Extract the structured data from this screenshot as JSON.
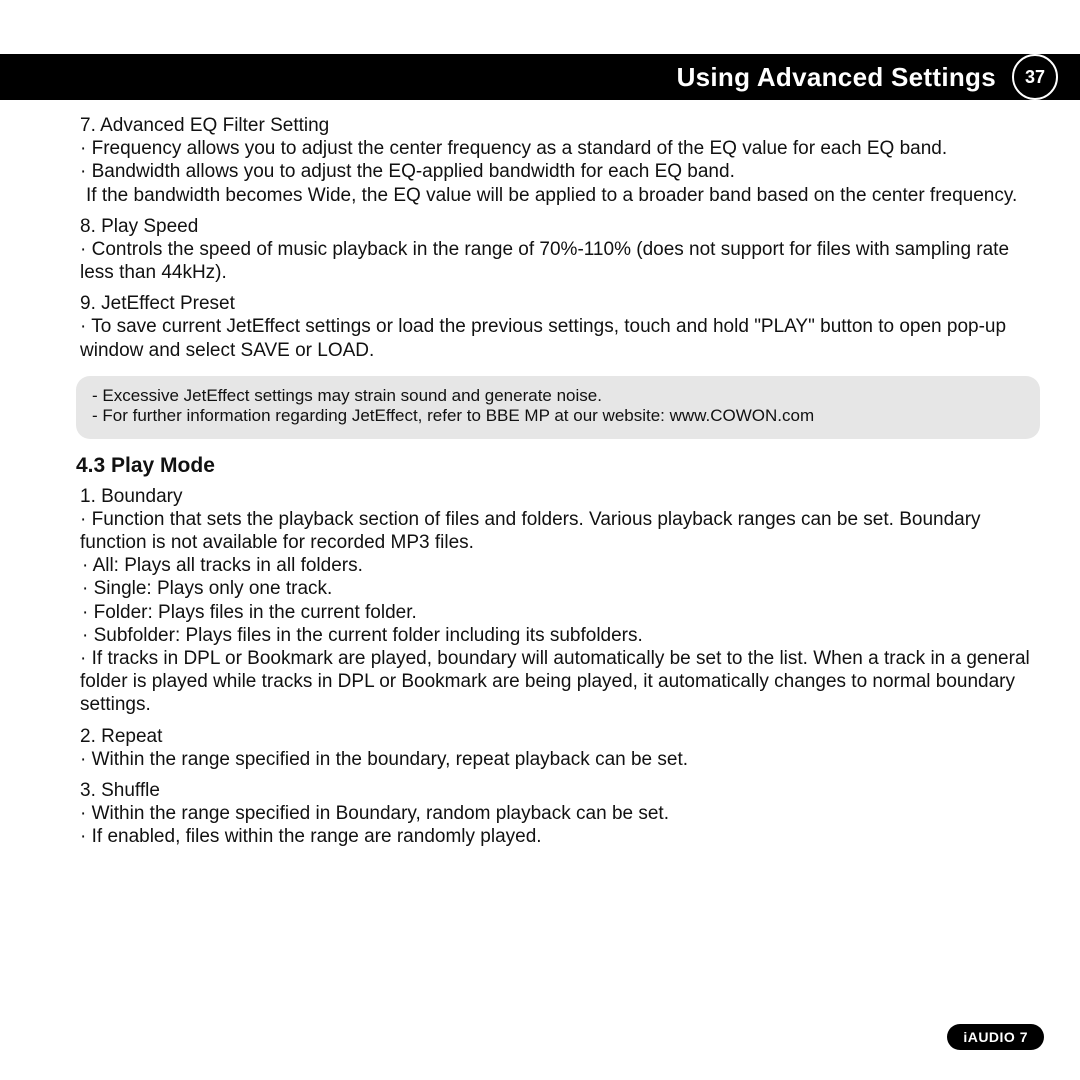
{
  "header": {
    "title": "Using Advanced Settings",
    "page": "37"
  },
  "eq": {
    "num": "7. Advanced EQ Filter Setting",
    "b1": "Frequency allows you to adjust the center frequency as a standard of the EQ value for each EQ band.",
    "b2": "Bandwidth allows you to adjust the EQ-applied bandwidth for each EQ band.",
    "cont": "If the bandwidth becomes Wide, the EQ value will be applied to a broader band based on the center frequency."
  },
  "speed": {
    "num": "8. Play Speed",
    "b1": "Controls the speed of music playback in the range of 70%-110% (does not support for files with sampling rate less than 44kHz)."
  },
  "preset": {
    "num": "9. JetEffect Preset",
    "b1": "To save current JetEffect settings or load the previous settings, touch and hold \"PLAY\" button to open pop-up window and select SAVE or LOAD."
  },
  "note": {
    "l1": "Excessive JetEffect settings may strain sound and generate noise.",
    "l2": "For further information regarding JetEffect, refer to BBE MP at our website: www.COWON.com"
  },
  "playmode": {
    "head": "4.3 Play Mode",
    "boundary_num": "1. Boundary",
    "boundary_b1": "Function that sets the playback section of files and folders. Various playback ranges can be set. Boundary function is not available for recorded MP3 files.",
    "opt_all": "All: Plays all tracks in all folders.",
    "opt_single": "Single: Plays only one track.",
    "opt_folder": "Folder: Plays files in the current folder.",
    "opt_subfolder": "Subfolder: Plays files in the current folder including its subfolders.",
    "boundary_b2": "If tracks in DPL or Bookmark are played, boundary will automatically be set to the list. When a track in a general folder is played while tracks in DPL or Bookmark are being played, it automatically changes to normal boundary settings.",
    "repeat_num": "2. Repeat",
    "repeat_b1": "Within the range specified in the boundary, repeat playback can be set.",
    "shuffle_num": "3. Shuffle",
    "shuffle_b1": "Within the range specified in Boundary, random playback can be set.",
    "shuffle_b2": "If enabled, files within the range are randomly played."
  },
  "footer": {
    "label": "iAUDIO 7"
  }
}
